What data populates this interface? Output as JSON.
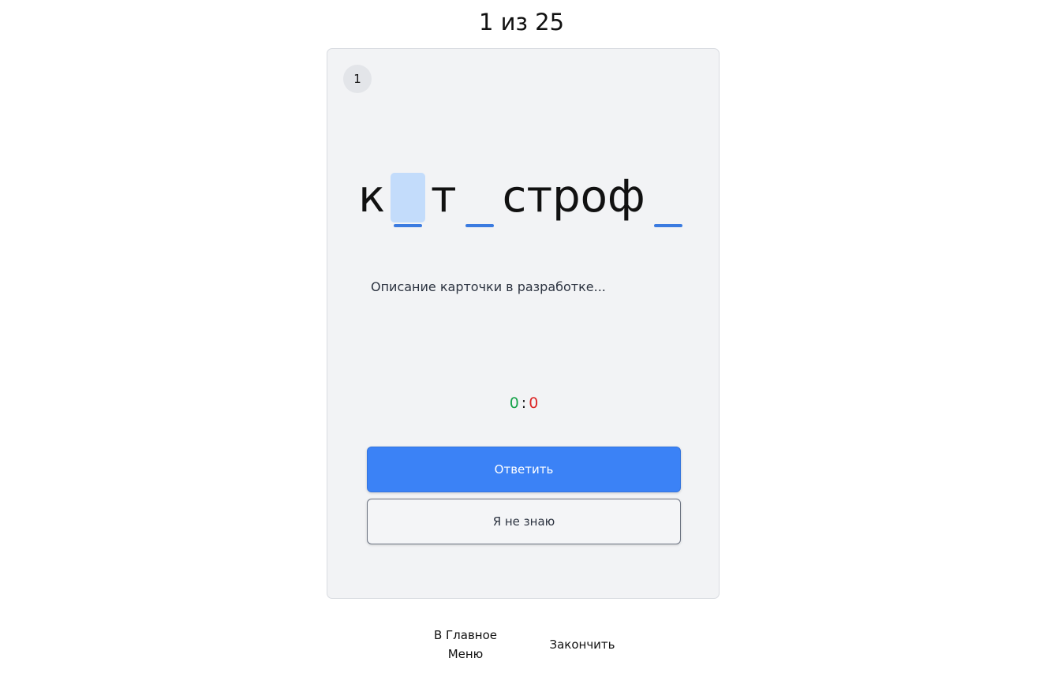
{
  "header": {
    "progress": "1 из 25"
  },
  "card": {
    "number": "1",
    "word": [
      {
        "type": "letter",
        "text": "к"
      },
      {
        "type": "gap",
        "active": true
      },
      {
        "type": "letter",
        "text": "т"
      },
      {
        "type": "gap",
        "active": false
      },
      {
        "type": "letter",
        "text": "строф"
      },
      {
        "type": "gap",
        "active": false
      }
    ],
    "description": "Описание карточки в разработке...",
    "score": {
      "correct": "0",
      "separator": ":",
      "wrong": "0"
    },
    "answer_button": "Ответить",
    "dont_know_button": "Я не знаю"
  },
  "footer": {
    "main_menu_label": "В Главное Меню",
    "finish_label": "Закончить"
  },
  "colors": {
    "primary": "#3b82f6",
    "gap_underline": "#3b7be0",
    "gap_active_fill": "#c3dcfb",
    "correct": "#17a34a",
    "wrong": "#dc2626"
  }
}
